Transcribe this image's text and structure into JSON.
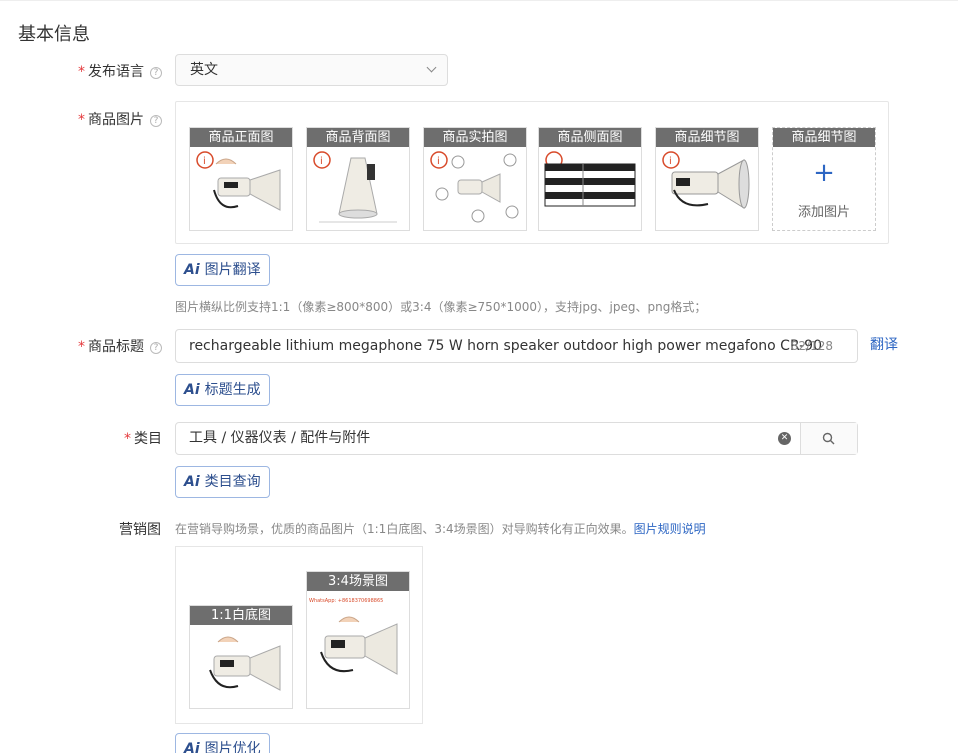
{
  "section_title": "基本信息",
  "language": {
    "label": "发布语言",
    "value": "英文"
  },
  "product_images": {
    "label": "商品图片",
    "items": [
      {
        "caption": "商品正面图"
      },
      {
        "caption": "商品背面图"
      },
      {
        "caption": "商品实拍图"
      },
      {
        "caption": "商品侧面图"
      },
      {
        "caption": "商品细节图"
      }
    ],
    "add_slot": {
      "caption": "商品细节图",
      "plus": "+",
      "text": "添加图片"
    },
    "translate_button": "图片翻译",
    "hint": "图片横纵比例支持1:1（像素≥800*800）或3:4（像素≥750*1000），支持jpg、jpeg、png格式；"
  },
  "title_field": {
    "label": "商品标题",
    "value": "rechargeable lithium megaphone 75 W horn speaker outdoor high power megafono CR-90",
    "count": "82/128",
    "translate_link": "翻译",
    "generate_button": "标题生成"
  },
  "category": {
    "label": "类目",
    "value": "工具 / 仪器仪表 / 配件与附件",
    "query_button": "类目查询"
  },
  "marketing": {
    "label": "营销图",
    "hint": "在营销导购场景，优质的商品图片（1:1白底图、3:4场景图）对导购转化有正向效果。",
    "hint_link": "图片规则说明",
    "square_caption": "1:1白底图",
    "scene_caption": "3:4场景图",
    "scene_watermark": "WhatsApp: +8618370698865",
    "optimize_button": "图片优化"
  },
  "ai_badge": "Ai",
  "colors": {
    "link": "#2d66c3",
    "required": "#e4393c",
    "caption_bg": "#6e6e6e"
  }
}
